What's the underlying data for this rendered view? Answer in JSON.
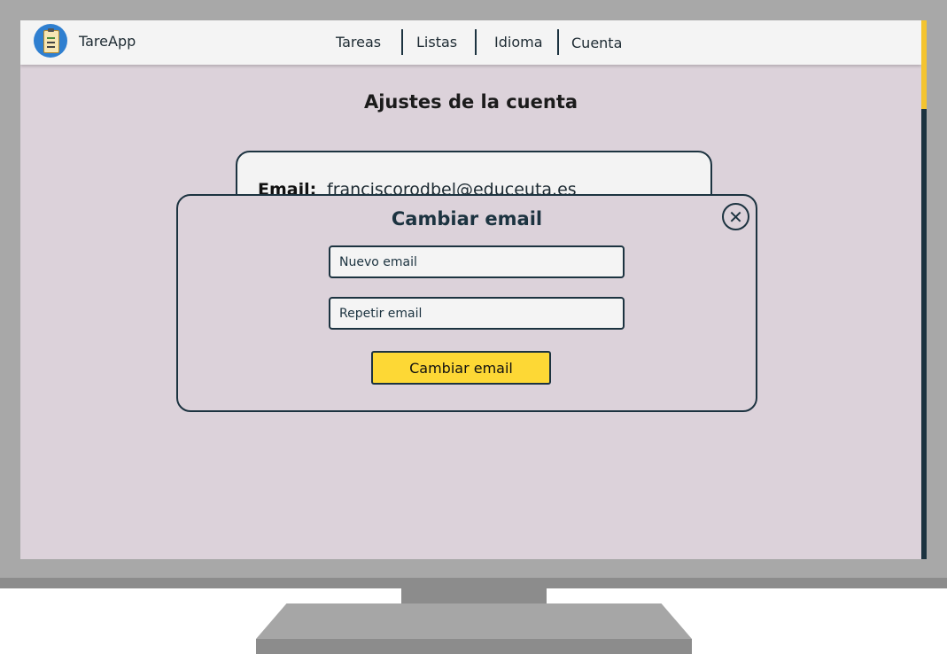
{
  "app": {
    "name": "TareApp",
    "logo_icon": "clipboard-icon"
  },
  "nav": {
    "items": [
      {
        "label": "Tareas"
      },
      {
        "label": "Listas"
      },
      {
        "label": "Idioma"
      },
      {
        "label": "Cuenta"
      }
    ]
  },
  "page": {
    "title": "Ajustes de la cuenta",
    "account": {
      "email_label": "Email:",
      "email_value": "franciscorodbel@educeuta.es"
    }
  },
  "modal": {
    "title": "Cambiar email",
    "close_icon": "close-circle-icon",
    "new_email_placeholder": "Nuevo email",
    "repeat_email_placeholder": "Repetir email",
    "submit_label": "Cambiar email"
  },
  "colors": {
    "accent": "#fdd835",
    "dark": "#1c3340",
    "screen_background": "#dcd2da",
    "navbar_background": "#f4f4f4"
  }
}
